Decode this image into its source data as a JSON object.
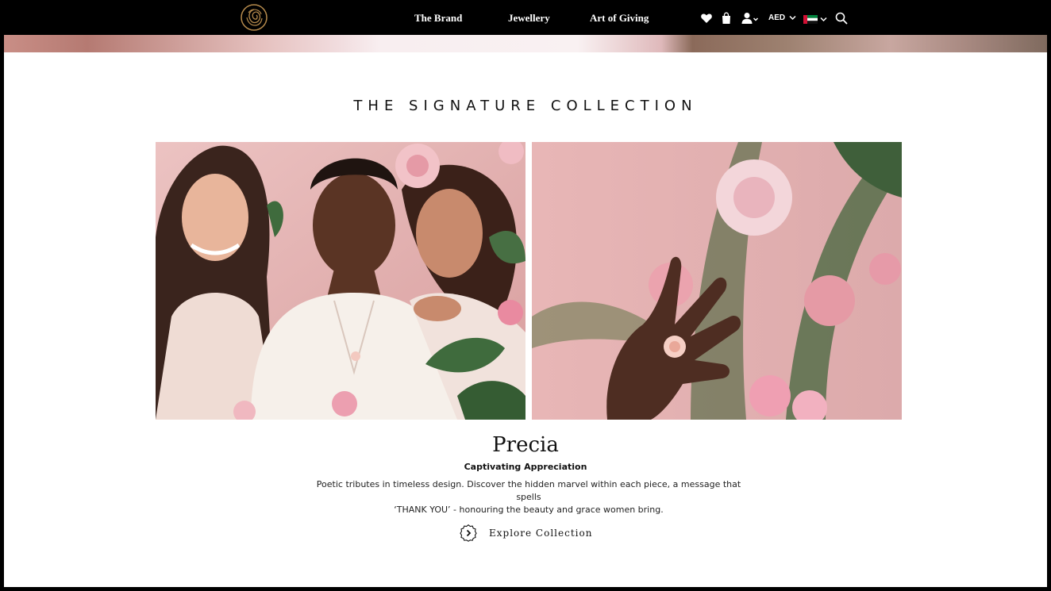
{
  "header": {
    "logo_icon": "rose-logo-icon",
    "nav": [
      {
        "label": "The Brand"
      },
      {
        "label": "Jewellery"
      },
      {
        "label": "Art of Giving"
      }
    ],
    "icons": [
      "heart-icon",
      "shopping-bag-icon",
      "user-icon",
      "search-icon"
    ],
    "currency": "AED",
    "country_flag": "uae-flag-icon"
  },
  "collection": {
    "section_title": "THE SIGNATURE COLLECTION",
    "images": [
      {
        "subject": "three-women-wearing-jewellery"
      },
      {
        "subject": "hand-with-rose-ring"
      }
    ],
    "name": "Precia",
    "tagline": "Captivating Appreciation",
    "description_line1": "Poetic tributes in timeless design. Discover the hidden marvel within each piece, a message that spells",
    "description_line2": "‘THANK YOU’ - honouring the beauty and grace women bring.",
    "cta_label": "Explore Collection",
    "cta_icon": "chevron-right-circle-icon"
  },
  "colors": {
    "header_bg": "#000000",
    "page_bg": "#ffffff",
    "accent_gold": "#b58a4c",
    "text": "#111111"
  }
}
